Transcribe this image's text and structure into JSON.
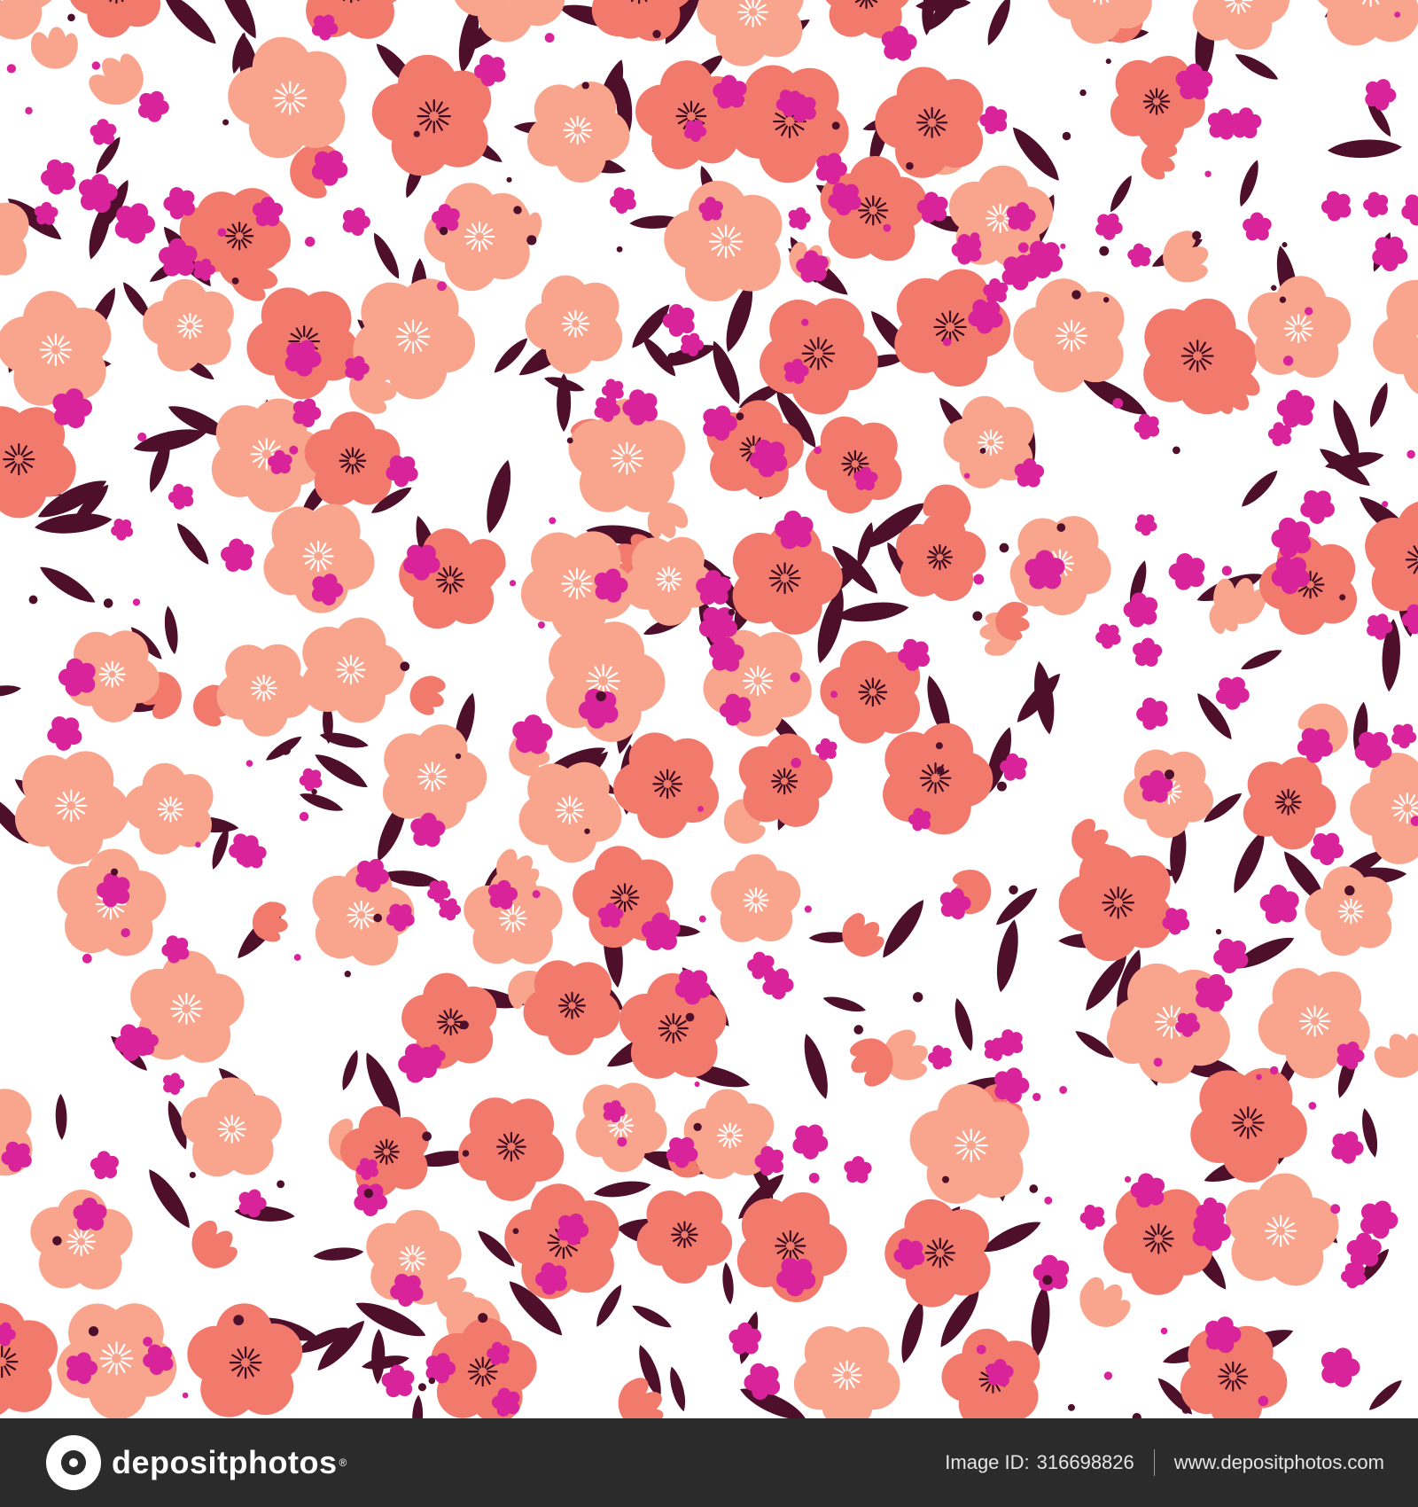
{
  "image": {
    "subject": "seamless floral pattern",
    "palette": {
      "background": "#ffffff",
      "coral_flower": "#f17a6d",
      "peach_flower": "#f9a58e",
      "magenta_blossom": "#d9239b",
      "leaf": "#4e0f2a",
      "flower_center_dark": "#3b0a1f",
      "flower_center_light": "#ffffff"
    }
  },
  "footer": {
    "brand": "depositphotos",
    "image_id_label": "Image ID:",
    "image_id": "316698826",
    "url": "www.depositphotos.com"
  }
}
